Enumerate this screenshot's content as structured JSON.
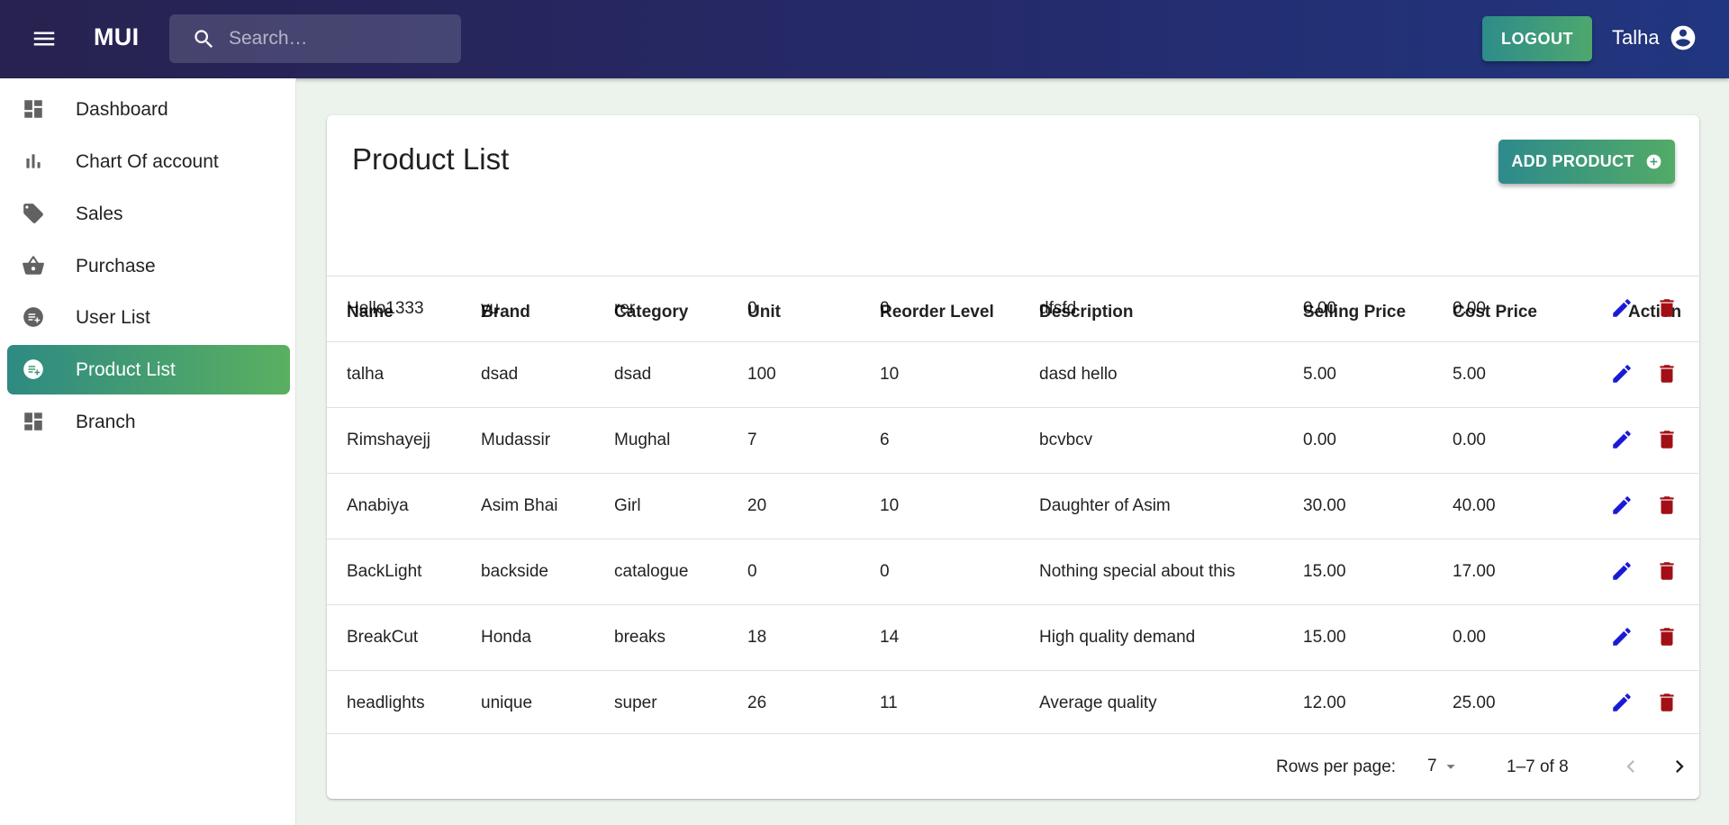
{
  "appbar": {
    "brand": "MUI",
    "search_placeholder": "Search…",
    "logout_label": "LOGOUT",
    "user_name": "Talha"
  },
  "sidebar": {
    "items": [
      {
        "label": "Dashboard",
        "icon": "dashboard-icon"
      },
      {
        "label": "Chart Of account",
        "icon": "bar-chart-icon"
      },
      {
        "label": "Sales",
        "icon": "tag-icon"
      },
      {
        "label": "Purchase",
        "icon": "basket-icon"
      },
      {
        "label": "User List",
        "icon": "playlist-add-icon"
      },
      {
        "label": "Product List",
        "icon": "playlist-add-icon",
        "active": true
      },
      {
        "label": "Branch",
        "icon": "dashboard-icon"
      }
    ]
  },
  "main": {
    "title": "Product List",
    "add_button_label": "ADD PRODUCT",
    "columns": [
      "Name",
      "Brand",
      "Category",
      "Unit",
      "Reorder Level",
      "Description",
      "Selling Price",
      "Cost Price",
      "Action"
    ],
    "rows": [
      [
        "Hello1333",
        "yu",
        "rer",
        "0",
        "0",
        "dfsfd",
        "0.00",
        "0.00"
      ],
      [
        "talha",
        "dsad",
        "dsad",
        "100",
        "10",
        "dasd hello",
        "5.00",
        "5.00"
      ],
      [
        "Rimshayejj",
        "Mudassir",
        "Mughal",
        "7",
        "6",
        "bcvbcv",
        "0.00",
        "0.00"
      ],
      [
        "Anabiya",
        "Asim Bhai",
        "Girl",
        "20",
        "10",
        "Daughter of Asim",
        "30.00",
        "40.00"
      ],
      [
        "BackLight",
        "backside",
        "catalogue",
        "0",
        "0",
        "Nothing special about this",
        "15.00",
        "17.00"
      ],
      [
        "BreakCut",
        "Honda",
        "breaks",
        "18",
        "14",
        "High quality demand",
        "15.00",
        "0.00"
      ],
      [
        "headlights",
        "unique",
        "super",
        "26",
        "11",
        "Average quality",
        "12.00",
        "25.00"
      ]
    ],
    "pagination": {
      "rows_per_page_label": "Rows per page:",
      "rows_per_page": "7",
      "range": "1–7 of 8"
    }
  },
  "colors": {
    "appbar_start": "#27224f",
    "appbar_end": "#213680",
    "accent_start": "#2e8a82",
    "accent_end": "#5ab060",
    "edit_icon": "#1a1ad6",
    "delete_icon": "#a30f16",
    "page_bg": "#ecf3ec"
  }
}
